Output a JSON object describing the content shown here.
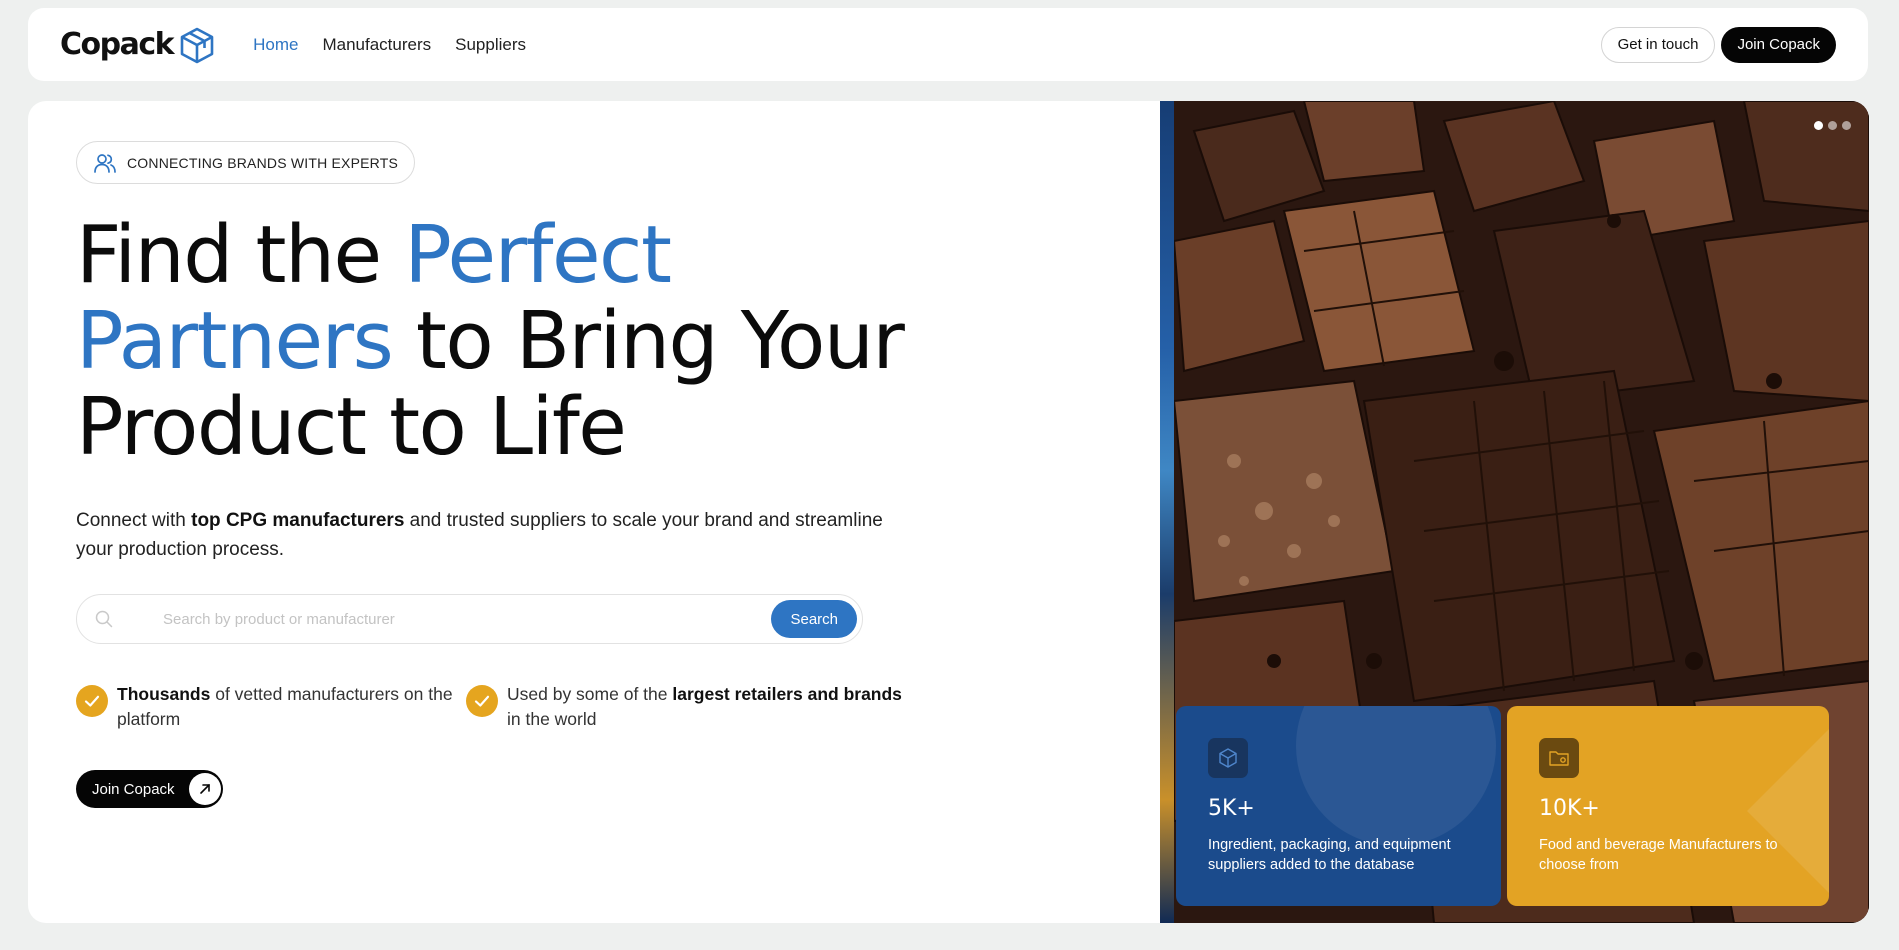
{
  "nav": {
    "logo": "Copack",
    "links": [
      {
        "label": "Home",
        "active": true
      },
      {
        "label": "Manufacturers",
        "active": false
      },
      {
        "label": "Suppliers",
        "active": false
      }
    ],
    "get_in_touch": "Get in touch",
    "join": "Join Copack"
  },
  "hero": {
    "badge": "CONNECTING BRANDS WITH EXPERTS",
    "headline": {
      "part1": "Find the ",
      "blue1": "Perfect",
      "blue2": "Partners",
      "part2": " to Bring Your",
      "part3": "Product to Life"
    },
    "subtitle": {
      "pre": "Connect with ",
      "bold": "top CPG manufacturers",
      "post": " and trusted suppliers to scale your brand and streamline your production process."
    },
    "search": {
      "placeholder": "Search by product or manufacturer",
      "button": "Search"
    },
    "features": [
      {
        "bold": "Thousands",
        "post": " of vetted manufacturers on the platform"
      },
      {
        "pre": "Used by some of the ",
        "bold": "largest retailers and brands",
        "post": " in the world"
      }
    ],
    "cta": "Join Copack"
  },
  "stats": [
    {
      "value": "5K+",
      "text": "Ingredient, packaging, and equipment suppliers added to the database",
      "icon": "cube-icon"
    },
    {
      "value": "10K+",
      "text": "Food and beverage Manufacturers to choose from",
      "icon": "folder-gear-icon"
    }
  ],
  "colors": {
    "brand_blue": "#2e75c3",
    "accent_gold": "#e5a51f",
    "stat_blue": "#1b4b8c",
    "stat_gold": "#e3a324"
  }
}
